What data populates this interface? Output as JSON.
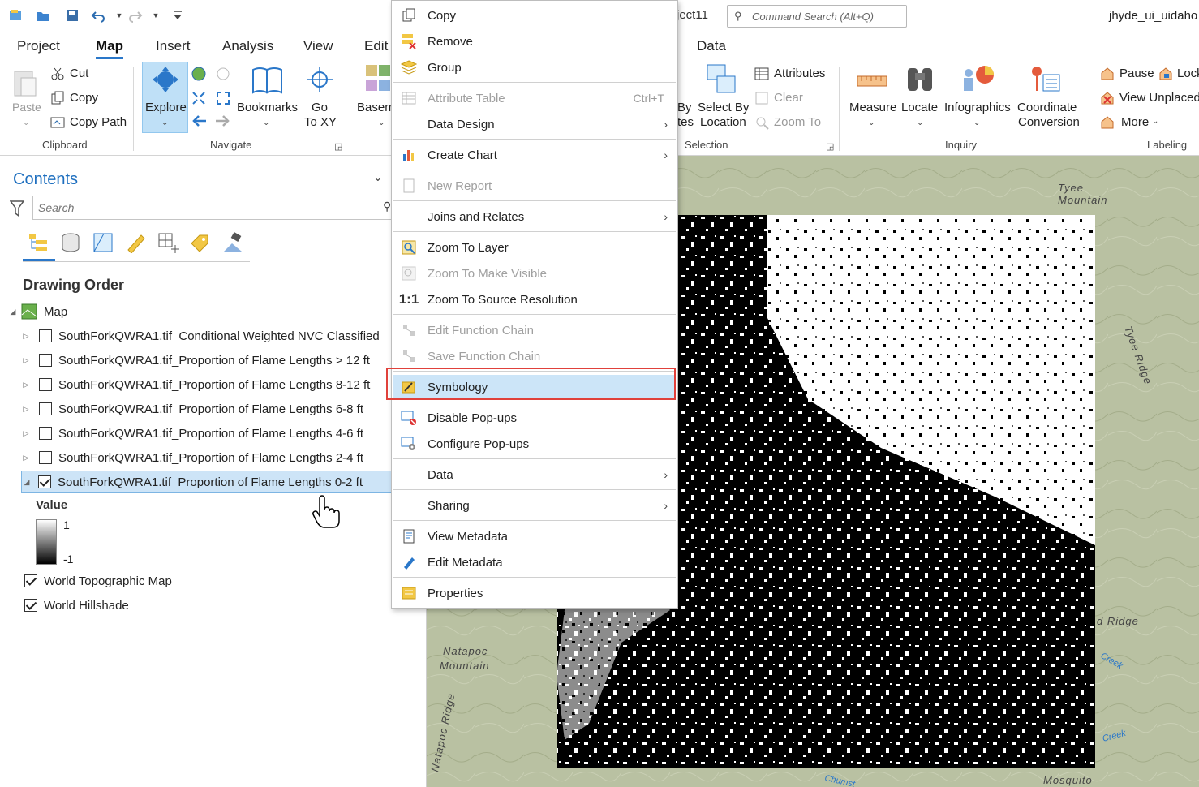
{
  "window": {
    "project_title": "ject11",
    "command_search_placeholder": "Command Search (Alt+Q)",
    "user": "jhyde_ui_uidaho"
  },
  "tabs": [
    "Project",
    "Map",
    "Insert",
    "Analysis",
    "View",
    "Edit",
    "Data"
  ],
  "active_tab": "Map",
  "ribbon": {
    "clipboard": {
      "paste": "Paste",
      "cut": "Cut",
      "copy": "Copy",
      "copy_path": "Copy Path",
      "label": "Clipboard"
    },
    "navigate": {
      "explore": "Explore",
      "bookmarks": "Bookmarks",
      "go": "Go",
      "to_xy": "To XY",
      "label": "Navigate"
    },
    "layer": {
      "basemap": "Basem"
    },
    "selection": {
      "by": "By",
      "by2": "tes",
      "select_by": "Select By",
      "location": "Location",
      "attributes": "Attributes",
      "clear": "Clear",
      "zoom_to": "Zoom To",
      "label": "Selection"
    },
    "inquiry": {
      "measure": "Measure",
      "locate": "Locate",
      "infographics": "Infographics",
      "coordinate": "Coordinate",
      "conversion": "Conversion",
      "label": "Inquiry"
    },
    "labeling": {
      "pause": "Pause",
      "lock": "Lock",
      "view_unplaced": "View Unplaced",
      "more": "More",
      "label": "Labeling"
    }
  },
  "contents": {
    "title": "Contents",
    "search_placeholder": "Search",
    "drawing_order": "Drawing Order",
    "map_label": "Map",
    "layers": [
      {
        "name": "SouthForkQWRA1.tif_Conditional Weighted NVC Classified",
        "checked": false
      },
      {
        "name": "SouthForkQWRA1.tif_Proportion of Flame Lengths > 12 ft",
        "checked": false
      },
      {
        "name": "SouthForkQWRA1.tif_Proportion of Flame Lengths 8-12 ft",
        "checked": false
      },
      {
        "name": "SouthForkQWRA1.tif_Proportion of Flame Lengths 6-8 ft",
        "checked": false
      },
      {
        "name": "SouthForkQWRA1.tif_Proportion of Flame Lengths 4-6 ft",
        "checked": false
      },
      {
        "name": "SouthForkQWRA1.tif_Proportion of Flame Lengths 2-4 ft",
        "checked": false
      },
      {
        "name": "SouthForkQWRA1.tif_Proportion of Flame Lengths 0-2 ft",
        "checked": true
      }
    ],
    "legend": {
      "title": "Value",
      "max": "1",
      "min": "-1"
    },
    "basemaps": [
      {
        "name": "World Topographic Map",
        "checked": true
      },
      {
        "name": "World Hillshade",
        "checked": true
      }
    ]
  },
  "context_menu": {
    "items": [
      {
        "label": "Copy",
        "icon": "copy-icon"
      },
      {
        "label": "Remove",
        "icon": "remove-icon"
      },
      {
        "label": "Group",
        "icon": "group-icon"
      },
      {
        "label": "Attribute Table",
        "shortcut": "Ctrl+T",
        "disabled": true,
        "icon": "table-icon"
      },
      {
        "label": "Data Design",
        "submenu": true
      },
      {
        "label": "Create Chart",
        "submenu": true,
        "icon": "chart-icon"
      },
      {
        "label": "New Report",
        "disabled": true,
        "icon": "report-icon"
      },
      {
        "label": "Joins and Relates",
        "submenu": true
      },
      {
        "label": "Zoom To Layer",
        "icon": "zoom-layer-icon"
      },
      {
        "label": "Zoom To Make Visible",
        "disabled": true,
        "icon": "zoom-visible-icon"
      },
      {
        "label": "Zoom To Source Resolution",
        "icon": "one-to-one-icon"
      },
      {
        "label": "Edit Function Chain",
        "disabled": true,
        "icon": "function-chain-icon"
      },
      {
        "label": "Save Function Chain",
        "disabled": true,
        "icon": "save-function-icon"
      },
      {
        "label": "Symbology",
        "highlighted": true,
        "icon": "symbology-icon"
      },
      {
        "label": "Disable Pop-ups",
        "icon": "disable-popup-icon"
      },
      {
        "label": "Configure Pop-ups",
        "icon": "configure-popup-icon"
      },
      {
        "label": "Data",
        "submenu": true
      },
      {
        "label": "Sharing",
        "submenu": true
      },
      {
        "label": "View Metadata",
        "icon": "view-metadata-icon"
      },
      {
        "label": "Edit Metadata",
        "icon": "edit-metadata-icon"
      },
      {
        "label": "Properties",
        "icon": "properties-icon"
      }
    ],
    "arrow_glyph": "›"
  },
  "map_labels": {
    "tyee_mountain_1": "Tyee",
    "tyee_mountain_2": "Mountain",
    "tyee_ridge": "Tyee Ridge",
    "natapoc_mountain_1": "Natapoc",
    "natapoc_mountain_2": "Mountain",
    "natapoc_ridge": "Natapoc Ridge",
    "ridge_right": "d Ridge",
    "creek_right": "Creek",
    "creek_right2": "Creek",
    "mosquito": "Mosquito",
    "chumstick": "Chumst"
  },
  "colors": {
    "accent": "#2a77c9",
    "selection": "#cde4f7",
    "highlight_box": "#e0413b",
    "menu_hover": "#cce5f8"
  }
}
